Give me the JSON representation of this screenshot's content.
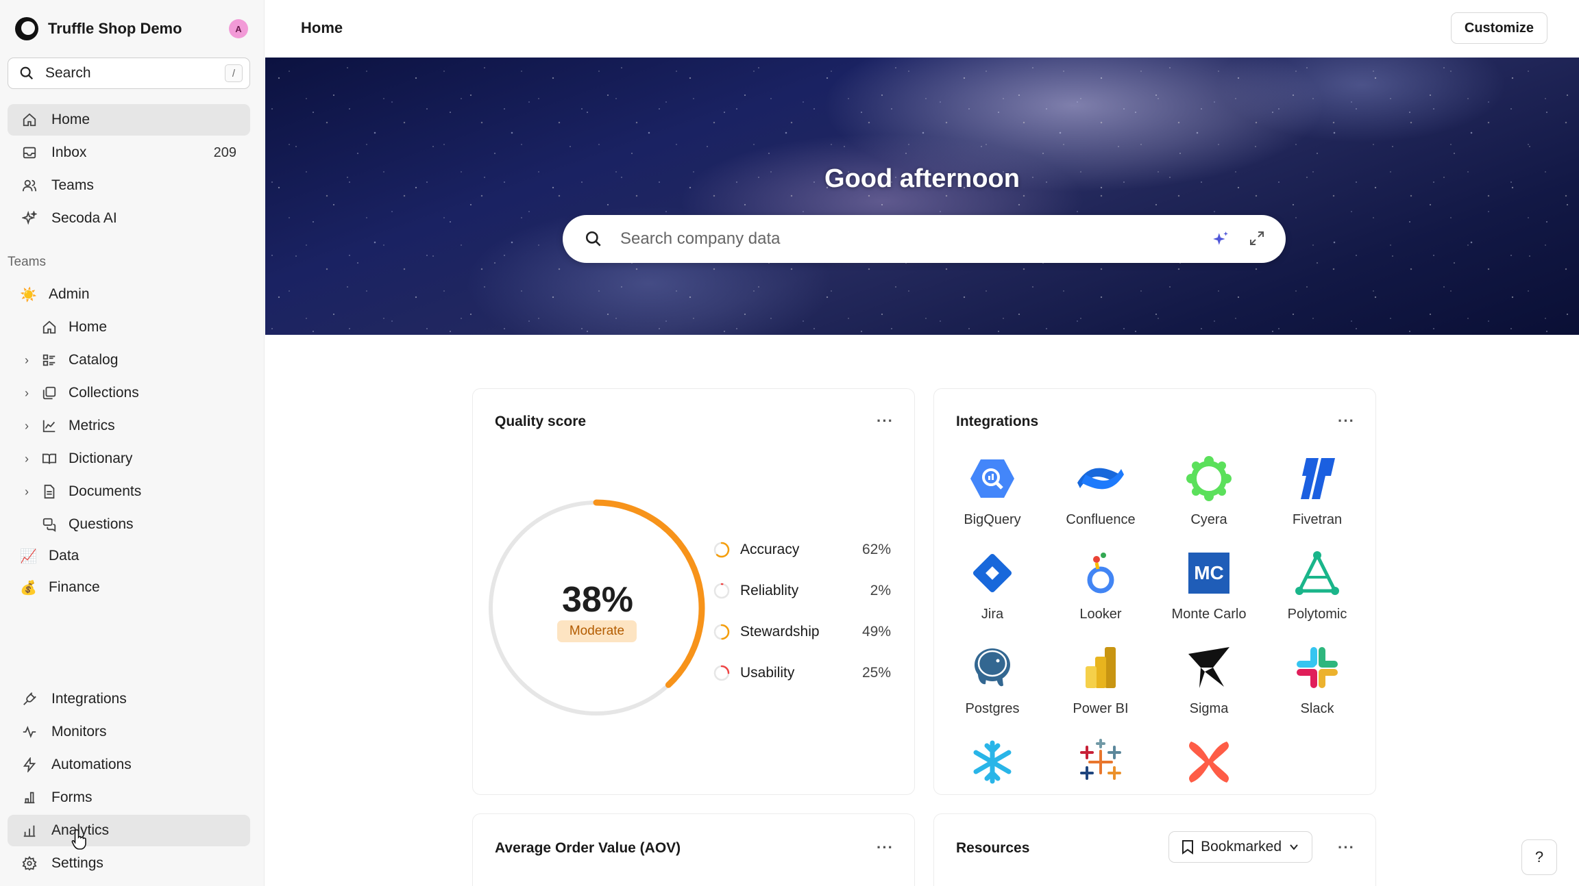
{
  "workspace": {
    "name": "Truffle Shop Demo",
    "avatar_initial": "A"
  },
  "sidebar": {
    "search": {
      "label": "Search",
      "shortcut": "/"
    },
    "main_items": [
      {
        "label": "Home",
        "icon": "home-icon",
        "active": true
      },
      {
        "label": "Inbox",
        "icon": "inbox-icon",
        "count": "209"
      },
      {
        "label": "Teams",
        "icon": "users-icon"
      },
      {
        "label": "Secoda AI",
        "icon": "sparkles-icon"
      }
    ],
    "teams_section_label": "Teams",
    "teams": [
      {
        "label": "Admin",
        "icon": "sun-emoji",
        "emoji": "☀️"
      },
      {
        "label": "Data",
        "icon": "chart-emoji",
        "emoji": "📈"
      },
      {
        "label": "Finance",
        "icon": "money-bag-emoji",
        "emoji": "💰"
      }
    ],
    "admin_sub_items": [
      {
        "label": "Home",
        "icon": "home-icon",
        "expandable": false
      },
      {
        "label": "Catalog",
        "icon": "catalog-icon",
        "expandable": true
      },
      {
        "label": "Collections",
        "icon": "collections-icon",
        "expandable": true
      },
      {
        "label": "Metrics",
        "icon": "metrics-icon",
        "expandable": true
      },
      {
        "label": "Dictionary",
        "icon": "book-icon",
        "expandable": true
      },
      {
        "label": "Documents",
        "icon": "document-icon",
        "expandable": true
      },
      {
        "label": "Questions",
        "icon": "questions-icon",
        "expandable": false
      }
    ],
    "bottom_items": [
      {
        "label": "Integrations",
        "icon": "plug-icon"
      },
      {
        "label": "Monitors",
        "icon": "pulse-icon"
      },
      {
        "label": "Automations",
        "icon": "bolt-icon"
      },
      {
        "label": "Forms",
        "icon": "forms-icon"
      },
      {
        "label": "Analytics",
        "icon": "bar-chart-icon",
        "active": true
      },
      {
        "label": "Settings",
        "icon": "gear-icon"
      }
    ]
  },
  "topbar": {
    "title": "Home",
    "customize_label": "Customize"
  },
  "hero": {
    "greeting": "Good afternoon",
    "search_placeholder": "Search company data"
  },
  "quality_card": {
    "title": "Quality score",
    "score_label": "38%",
    "score": 0.38,
    "rating": "Moderate",
    "metrics": [
      {
        "label": "Accuracy",
        "value_label": "62%",
        "value": 0.62,
        "color": "#f59e0b"
      },
      {
        "label": "Reliablity",
        "value_label": "2%",
        "value": 0.02,
        "color": "#ef4444"
      },
      {
        "label": "Stewardship",
        "value_label": "49%",
        "value": 0.49,
        "color": "#f59e0b"
      },
      {
        "label": "Usability",
        "value_label": "25%",
        "value": 0.25,
        "color": "#ef4444"
      }
    ]
  },
  "integrations_card": {
    "title": "Integrations",
    "items": [
      {
        "name": "BigQuery",
        "icon": "bigquery-icon"
      },
      {
        "name": "Confluence",
        "icon": "confluence-icon"
      },
      {
        "name": "Cyera",
        "icon": "cyera-icon"
      },
      {
        "name": "Fivetran",
        "icon": "fivetran-icon"
      },
      {
        "name": "Jira",
        "icon": "jira-icon"
      },
      {
        "name": "Looker",
        "icon": "looker-icon"
      },
      {
        "name": "Monte Carlo",
        "icon": "monte-carlo-icon",
        "logo_text": "MC"
      },
      {
        "name": "Polytomic",
        "icon": "polytomic-icon"
      },
      {
        "name": "Postgres",
        "icon": "postgres-icon"
      },
      {
        "name": "Power BI",
        "icon": "power-bi-icon"
      },
      {
        "name": "Sigma",
        "icon": "sigma-icon"
      },
      {
        "name": "Slack",
        "icon": "slack-icon"
      },
      {
        "name": "",
        "icon": "snowflake-icon"
      },
      {
        "name": "",
        "icon": "tableau-icon"
      },
      {
        "name": "",
        "icon": "dbt-icon"
      }
    ]
  },
  "aov_card": {
    "title": "Average Order Value (AOV)"
  },
  "resources_card": {
    "title": "Resources",
    "filter_label": "Bookmarked"
  },
  "help": {
    "label": "?"
  },
  "colors": {
    "accent_orange": "#f7931a",
    "ring_track": "#e6e6e6",
    "sidebar_bg": "#f7f7f7"
  }
}
